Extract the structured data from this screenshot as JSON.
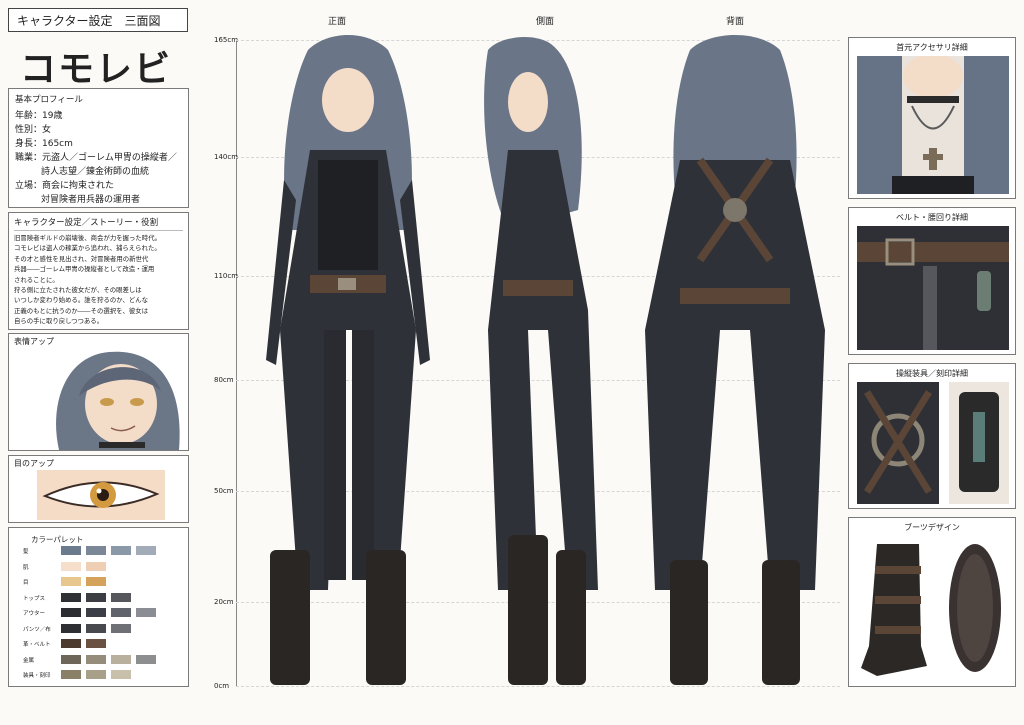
{
  "sheet_title": "キャラクター設定　三面図",
  "character_name": "コモレビ",
  "profile": {
    "heading": "基本プロフィール",
    "rows": [
      "年齢：19歳",
      "性別：女",
      "身長：165cm",
      "職業：元盗人／ゴーレム甲冑の操縦者／",
      "詩人志望／錬金術師の血統",
      "立場：商会に拘束された",
      "対冒険者用兵器の運用者"
    ]
  },
  "story": {
    "heading": "キャラクター設定／ストーリー・役割",
    "lines": [
      "旧冒険者ギルドの崩壊後、商会が力を握った時代。",
      "コモレビは盗人の稼業から追われ、捕らえられた。",
      "その才と感性を見出され、対冒険者用の新世代",
      "兵器――ゴーレム甲冑の操縦者として改造・運用",
      "されることに。",
      "狩る側に立たされた彼女だが、その眼差しは",
      "いつしか変わり始める。誰を狩るのか、どんな",
      "正義のもとに抗うのか――その選択を、彼女は",
      "自らの手に取り戻しつつある。"
    ]
  },
  "face_label": "表情アップ",
  "eye_label": "目のアップ",
  "palette": {
    "heading": "カラーパレット",
    "rows": [
      {
        "name": "髪",
        "colors": [
          "#6b7a8c",
          "#7b8797",
          "#8b98a8",
          "#a2acb8"
        ]
      },
      {
        "name": "肌",
        "colors": [
          "#f6dfca",
          "#efcfb3"
        ]
      },
      {
        "name": "目",
        "colors": [
          "#e8c78f",
          "#d5a25a"
        ]
      },
      {
        "name": "トップス",
        "colors": [
          "#2f3034",
          "#3c3d42",
          "#55575d"
        ]
      },
      {
        "name": "アウター",
        "colors": [
          "#2b2d33",
          "#3b3e46",
          "#60636b",
          "#8a8d94"
        ]
      },
      {
        "name": "パンツ／布",
        "colors": [
          "#2e2f33",
          "#48494e",
          "#6e7075"
        ]
      },
      {
        "name": "革・ベルト",
        "colors": [
          "#4d3a2e",
          "#6a5141"
        ]
      },
      {
        "name": "金属",
        "colors": [
          "#6f665a",
          "#968c7c",
          "#b9af9d",
          "#8d8e90"
        ]
      },
      {
        "name": "装具・刻印",
        "colors": [
          "#8a8067",
          "#a9a08a",
          "#c8c0ab"
        ]
      }
    ]
  },
  "views": [
    "正面",
    "側面",
    "背面"
  ],
  "ruler": [
    "165cm",
    "140cm",
    "110cm",
    "80cm",
    "50cm",
    "20cm",
    "0cm"
  ],
  "detail_panels": [
    "首元アクセサリ詳細",
    "ベルト・腰回り詳細",
    "操縦装具／刻印詳細",
    "ブーツデザイン"
  ]
}
